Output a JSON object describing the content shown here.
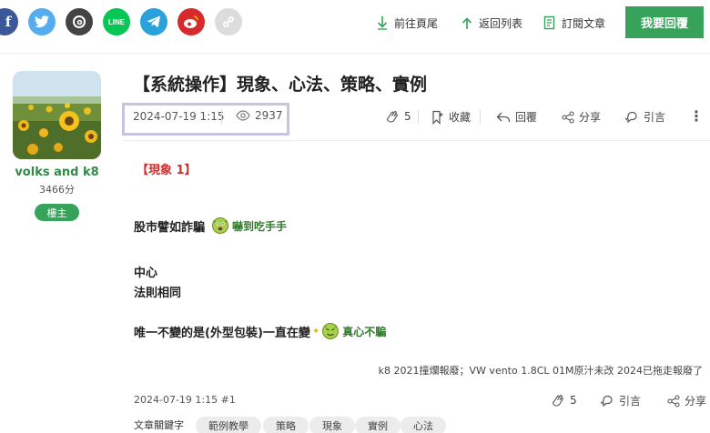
{
  "share_bar": {
    "facebook": "f",
    "line": "LINE",
    "icons": [
      "facebook-icon",
      "twitter-icon",
      "threads-icon",
      "line-icon",
      "telegram-icon",
      "weibo-icon",
      "link-icon"
    ]
  },
  "nav": {
    "last_page": "前往頁尾",
    "back_to_list": "返回列表",
    "subscribe": "訂閱文章",
    "reply_button": "我要回覆"
  },
  "author": {
    "name": "volks and k8",
    "points": "3466分",
    "badge": "樓主"
  },
  "post": {
    "title": "【系統操作】現象、心法、策略、實例",
    "date": "2024-07-19 1:15",
    "views": "2937",
    "actions": {
      "like_count": "5",
      "favorite": "收藏",
      "reply": "回覆",
      "share": "分享",
      "quote": "引言",
      "more": "⋮"
    },
    "section_title": "【現象 1】",
    "line1": "股市譬如詐騙",
    "emoticon1": "嚇到吃手手",
    "line2": "中心",
    "line3": "法則相同",
    "line4": "唯一不變的是(外型包裝)一直在變",
    "sparkle": "✦",
    "emoticon2": "真心不騙",
    "signature": "k8 2021撞爛報廢；VW vento 1.8CL 01M原汁未改 2024已拖走報廢了"
  },
  "footer": {
    "floor": "2024-07-19 1:15 #1",
    "like_count": "5",
    "quote": "引言",
    "share": "分享",
    "tags_label": "文章關鍵字",
    "tags": [
      "範例教學",
      "策略",
      "現象",
      "實例",
      "心法"
    ]
  },
  "colors": {
    "accent_green": "#36a25a",
    "author_green": "#2f8b46",
    "section_red": "#d62d2d",
    "highlight_box": "#c7c4e2"
  }
}
